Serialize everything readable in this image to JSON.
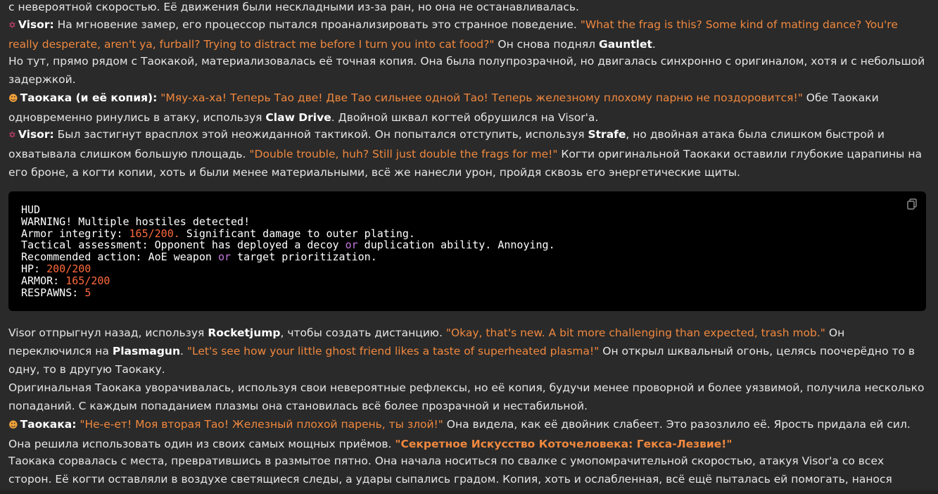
{
  "p0": {
    "t1": "с невероятной скоростью. Её движения были нескладными из-за ран, но она не останавливалась."
  },
  "p1": {
    "speaker": "Visor:",
    "t1": " На мгновение замер, его процессор пытался проанализировать это странное поведение. ",
    "q1": "\"What the frag is this? Some kind of mating dance? You're really desperate, aren't ya, furball? Trying to distract me before I turn you into cat food?\"",
    "t2": " Он снова поднял ",
    "b1": "Gauntlet",
    "t3": "."
  },
  "p2": {
    "t1": "Но тут, прямо рядом с Таокакой, материализовалась её точная копия. Она была полупрозрачной, но двигалась синхронно с оригиналом, хотя и с небольшой задержкой."
  },
  "p3": {
    "speaker": "Таокака (и её копия):",
    "q1": "\"Мяу-ха-ха! Теперь Тао две! Две Тао сильнее одной Тао! Теперь железному плохому парню не поздоровится!\"",
    "t1": " Обе Таокаки одновременно ринулись в атаку, используя ",
    "b1": "Claw Drive",
    "t2": ". Двойной шквал когтей обрушился на Visor'a."
  },
  "p4": {
    "speaker": "Visor:",
    "t1": " Был застигнут врасплох этой неожиданной тактикой. Он попытался отступить, используя ",
    "b1": "Strafe",
    "t2": ", но двойная атака была слишком быстрой и охватывала слишком большую площадь. ",
    "q1": "\"Double trouble, huh? Still just double the frags for me!\"",
    "t3": " Когти оригинальной Таокаки оставили глубокие царапины на его броне, а когти копии, хоть и были менее материальными, всё же нанесли урон, пройдя сквозь его энергетические щиты."
  },
  "code": {
    "l1": "HUD",
    "l2a": "WARNING",
    "l2b": "! Multiple hostiles detected!",
    "l3a": "Armor integrity: ",
    "l3b": "165/200.",
    "l3c": " Significant damage to outer plating.",
    "l4a": "Tactical assessment: Opponent has deployed a decoy ",
    "l4b": "or",
    "l4c": " duplication ability. Annoying.",
    "l5a": "Recommended action: AoE weapon ",
    "l5b": "or",
    "l5c": " target prioritization.",
    "l6a": "HP: ",
    "l6b": "200/200",
    "l7a": "ARMOR: ",
    "l7b": "165/200",
    "l8a": "RESPAWNS: ",
    "l8b": "5"
  },
  "p5": {
    "t1": "Visor отпрыгнул назад, используя ",
    "b1": "Rocketjump",
    "t2": ", чтобы создать дистанцию. ",
    "q1": "\"Okay, that's new. A bit more challenging than expected, trash mob.\"",
    "t3": " Он переключился на ",
    "b2": "Plasmagun",
    "t4": ". ",
    "q2": "\"Let's see how your little ghost friend likes a taste of superheated plasma!\"",
    "t5": " Он открыл шквальный огонь, целясь поочерёдно то в одну, то в другую Таокаку."
  },
  "p6": {
    "t1": "Оригинальная Таокака уворачивалась, используя свои невероятные рефлексы, но её копия, будучи менее проворной и более уязвимой, получила несколько попаданий. С каждым попаданием плазмы она становилась всё более прозрачной и нестабильной."
  },
  "p7": {
    "speaker": "Таокака:",
    "q1": "\"Не-е-ет! Моя вторая Тао! Железный плохой парень, ты злой!\"",
    "t1": " Она видела, как её двойник слабеет. Это разозлило её. Ярость придала ей сил. Она решила использовать один из своих самых мощных приёмов. ",
    "q2": "\"Секретное Искусство Коточеловека: Гекса-Лезвие!\""
  },
  "p8": {
    "t1": "Таокака сорвалась с места, превратившись в размытое пятно. Она начала носиться по свалке с умопомрачительной скоростью, атакуя Visor'a со всех сторон. Её когти оставляли в воздухе светящиеся следы, а удары сыпались градом. Копия, хоть и ослабленная, всё ещё пыталась ей помогать, нанося"
  },
  "icons": {
    "visor": "anger-symbol-icon",
    "taokaka": "cat-face-icon",
    "copy": "copy-icon"
  }
}
